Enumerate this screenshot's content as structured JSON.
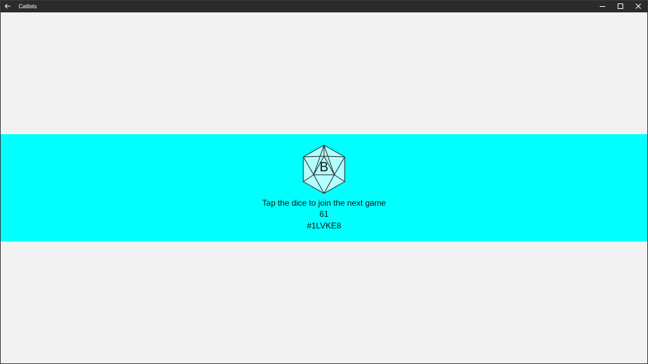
{
  "window": {
    "title": "Catlists"
  },
  "theme": {
    "banner_color": "#00ffff",
    "background_color": "#f2f2f2",
    "titlebar_color": "#2b2b2b",
    "dice_fill": "#b3ffff"
  },
  "icons": {
    "back": "arrow-left-icon",
    "minimize": "minimize-icon",
    "maximize": "maximize-icon",
    "close": "close-icon",
    "dice": "d20-dice-icon"
  },
  "game": {
    "dice_letter": "B",
    "prompt": "Tap the dice to join the next game",
    "count": "61",
    "code": "#1LVKE8"
  }
}
